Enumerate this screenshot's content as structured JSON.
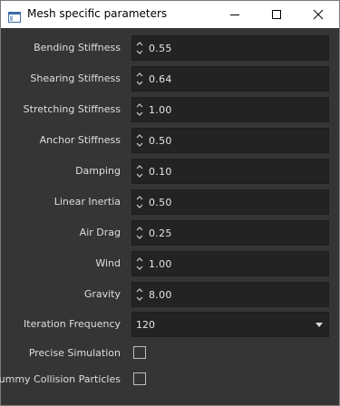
{
  "window": {
    "title": "Mesh specific parameters"
  },
  "titlebar_buttons": [
    "minimize-icon",
    "maximize-icon",
    "close-icon"
  ],
  "params": [
    {
      "label": "Bending Stiffness",
      "value": "0.55"
    },
    {
      "label": "Shearing Stiffness",
      "value": "0.64"
    },
    {
      "label": "Stretching Stiffness",
      "value": "1.00"
    },
    {
      "label": "Anchor Stiffness",
      "value": "0.50"
    },
    {
      "label": "Damping",
      "value": "0.10"
    },
    {
      "label": "Linear Inertia",
      "value": "0.50"
    },
    {
      "label": "Air Drag",
      "value": "0.25"
    },
    {
      "label": "Wind",
      "value": "1.00"
    },
    {
      "label": "Gravity",
      "value": "8.00"
    }
  ],
  "iteration_frequency": {
    "label": "Iteration Frequency",
    "selected": "120"
  },
  "precise_simulation": {
    "label": "Precise Simulation",
    "checked": false
  },
  "dummy_collision_particles": {
    "label": "Dummy Collision Particles",
    "checked": false
  },
  "colors": {
    "background": "#353535",
    "field": "#232323",
    "text": "#dedede",
    "titlebar": "#ffffff"
  }
}
